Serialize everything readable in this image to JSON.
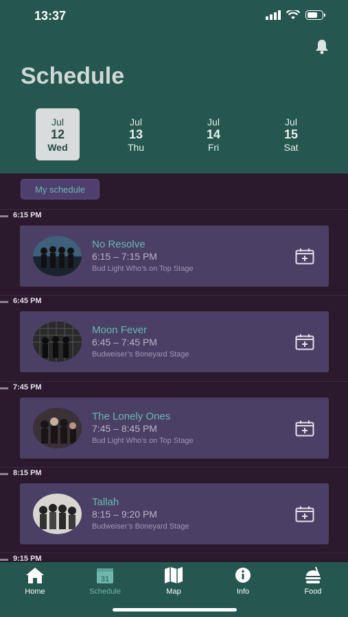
{
  "status": {
    "time": "13:37"
  },
  "header": {
    "title": "Schedule"
  },
  "dates": [
    {
      "month": "Jul",
      "day": "12",
      "weekday": "Wed",
      "active": true
    },
    {
      "month": "Jul",
      "day": "13",
      "weekday": "Thu",
      "active": false
    },
    {
      "month": "Jul",
      "day": "14",
      "weekday": "Fri",
      "active": false
    },
    {
      "month": "Jul",
      "day": "15",
      "weekday": "Sat",
      "active": false
    }
  ],
  "my_schedule_label": "My schedule",
  "slots": [
    {
      "time": "6:15 PM",
      "name": "No Resolve",
      "range": "6:15 – 7:15 PM",
      "stage": "Bud Light Who’s on Top Stage"
    },
    {
      "time": "6:45 PM",
      "name": "Moon Fever",
      "range": "6:45 – 7:45 PM",
      "stage": "Budweiser’s Boneyard Stage"
    },
    {
      "time": "7:45 PM",
      "name": "The Lonely Ones",
      "range": "7:45 – 8:45 PM",
      "stage": "Bud Light Who’s on Top Stage"
    },
    {
      "time": "8:15 PM",
      "name": "Tallah",
      "range": "8:15 – 9:20 PM",
      "stage": "Budweiser’s Boneyard Stage"
    },
    {
      "time": "9:15 PM"
    }
  ],
  "tabs": [
    {
      "label": "Home",
      "icon": "home-icon",
      "active": false
    },
    {
      "label": "Schedule",
      "icon": "calendar-icon",
      "active": true,
      "badge": "31"
    },
    {
      "label": "Map",
      "icon": "map-icon",
      "active": false
    },
    {
      "label": "Info",
      "icon": "info-icon",
      "active": false
    },
    {
      "label": "Food",
      "icon": "food-icon",
      "active": false
    }
  ],
  "colors": {
    "header_bg": "#25564f",
    "page_bg": "#2b1a2e",
    "card_bg": "#4c3f66",
    "accent": "#66b9ae"
  }
}
